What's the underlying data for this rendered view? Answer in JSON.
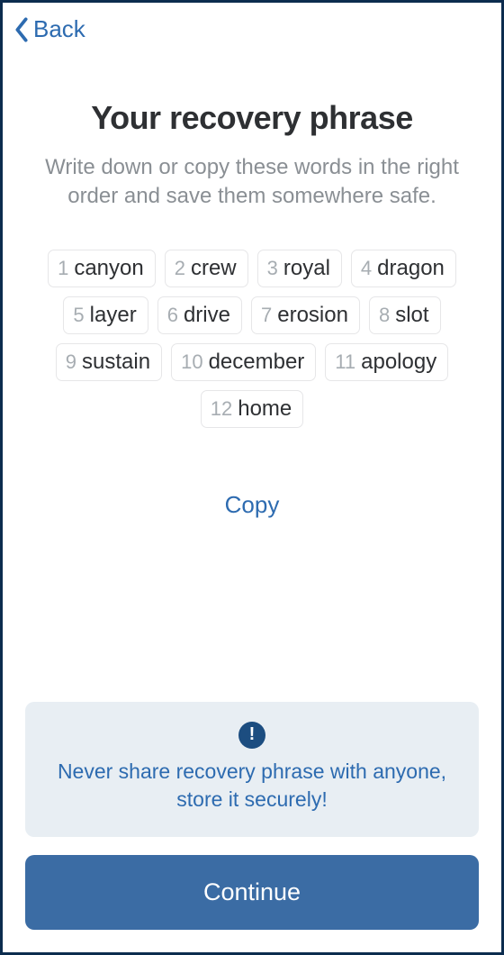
{
  "nav": {
    "back_label": "Back"
  },
  "header": {
    "title": "Your recovery phrase",
    "subtitle": "Write down or copy these words in the right order and save them somewhere safe."
  },
  "recovery_words": [
    {
      "index": "1",
      "word": "canyon"
    },
    {
      "index": "2",
      "word": "crew"
    },
    {
      "index": "3",
      "word": "royal"
    },
    {
      "index": "4",
      "word": "dragon"
    },
    {
      "index": "5",
      "word": "layer"
    },
    {
      "index": "6",
      "word": "drive"
    },
    {
      "index": "7",
      "word": "erosion"
    },
    {
      "index": "8",
      "word": "slot"
    },
    {
      "index": "9",
      "word": "sustain"
    },
    {
      "index": "10",
      "word": "december"
    },
    {
      "index": "11",
      "word": "apology"
    },
    {
      "index": "12",
      "word": "home"
    }
  ],
  "actions": {
    "copy_label": "Copy",
    "continue_label": "Continue"
  },
  "notice": {
    "text": "Never share recovery phrase with anyone, store it securely!"
  }
}
